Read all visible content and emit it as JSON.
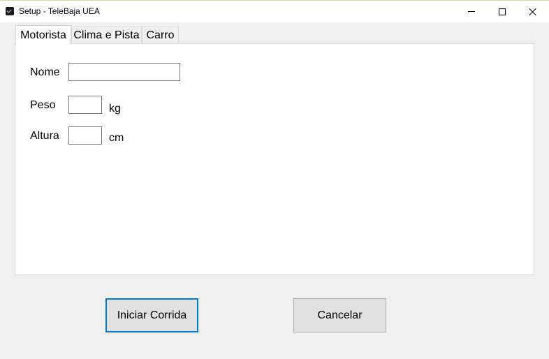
{
  "window": {
    "title": "Setup - TeleBaja UEA"
  },
  "tabs": [
    {
      "label": "Motorista",
      "active": true
    },
    {
      "label": "Clima e Pista",
      "active": false
    },
    {
      "label": "Carro",
      "active": false
    }
  ],
  "form": {
    "nome": {
      "label": "Nome",
      "value": ""
    },
    "peso": {
      "label": "Peso",
      "value": "",
      "unit": "kg"
    },
    "altura": {
      "label": "Altura",
      "value": "",
      "unit": "cm"
    }
  },
  "actions": {
    "start_label": "Iniciar Corrida",
    "cancel_label": "Cancelar"
  },
  "colors": {
    "accent": "#0078d7",
    "window_bg": "#f0f0f0",
    "panel_bg": "#ffffff"
  },
  "icons": {
    "app": "app-icon",
    "minimize": "minimize-icon",
    "maximize": "maximize-icon",
    "close": "close-icon"
  }
}
